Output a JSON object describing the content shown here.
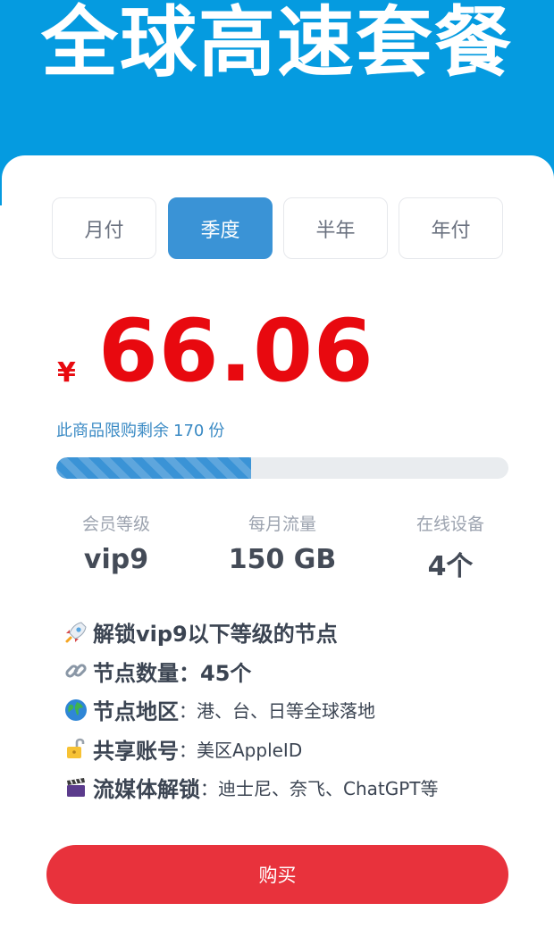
{
  "header": {
    "title": "全球高速套餐"
  },
  "plan_tabs": [
    {
      "label": "月付",
      "active": false
    },
    {
      "label": "季度",
      "active": true
    },
    {
      "label": "半年",
      "active": false
    },
    {
      "label": "年付",
      "active": false
    }
  ],
  "price": {
    "currency": "¥",
    "amount": "66.06"
  },
  "stock": {
    "prefix": "此商品限购剩余",
    "count": "170",
    "suffix": "份",
    "progress_fraction": 0.43
  },
  "stats": [
    {
      "label": "会员等级",
      "value": "vip9"
    },
    {
      "label": "每月流量",
      "value": "150 GB"
    },
    {
      "label": "在线设备",
      "value": "4个"
    }
  ],
  "features": [
    {
      "icon": "rocket-icon",
      "head": "解锁vip9以下等级的节点",
      "sep": "",
      "desc": ""
    },
    {
      "icon": "link-icon",
      "head": "节点数量：45个",
      "sep": "",
      "desc": ""
    },
    {
      "icon": "globe-icon",
      "head": "节点地区",
      "sep": "：",
      "desc": "港、台、日等全球落地"
    },
    {
      "icon": "unlocked-lock-icon",
      "head": "共享账号",
      "sep": "：",
      "desc": "美区AppleID"
    },
    {
      "icon": "clapperboard-icon",
      "head": "流媒体解锁",
      "sep": "：",
      "desc": "迪士尼、奈飞、ChatGPT等"
    }
  ],
  "buy_button": {
    "label": "购买"
  },
  "colors": {
    "brand_blue": "#059be0",
    "accent_blue": "#3a93d6",
    "price_red": "#e8090f",
    "buy_red": "#e8323c"
  }
}
